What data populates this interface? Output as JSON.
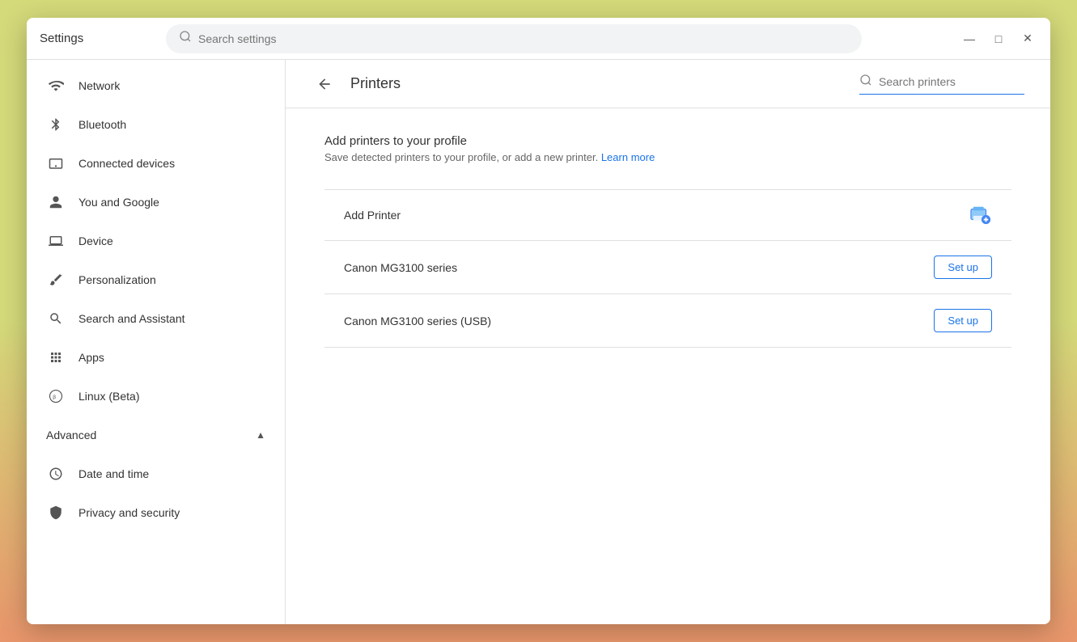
{
  "window": {
    "title": "Settings",
    "controls": {
      "minimize": "—",
      "maximize": "□",
      "close": "✕"
    }
  },
  "header": {
    "search_placeholder": "Search settings"
  },
  "sidebar": {
    "items": [
      {
        "id": "network",
        "label": "Network",
        "icon": "wifi"
      },
      {
        "id": "bluetooth",
        "label": "Bluetooth",
        "icon": "bluetooth"
      },
      {
        "id": "connected-devices",
        "label": "Connected devices",
        "icon": "tablet"
      },
      {
        "id": "you-and-google",
        "label": "You and Google",
        "icon": "person"
      },
      {
        "id": "device",
        "label": "Device",
        "icon": "laptop"
      },
      {
        "id": "personalization",
        "label": "Personalization",
        "icon": "brush"
      },
      {
        "id": "search-and-assistant",
        "label": "Search and Assistant",
        "icon": "search"
      },
      {
        "id": "apps",
        "label": "Apps",
        "icon": "apps"
      },
      {
        "id": "linux-beta",
        "label": "Linux (Beta)",
        "icon": "linux"
      }
    ],
    "advanced": {
      "label": "Advanced",
      "expanded": true,
      "items": [
        {
          "id": "date-and-time",
          "label": "Date and time",
          "icon": "clock"
        },
        {
          "id": "privacy-and-security",
          "label": "Privacy and security",
          "icon": "shield"
        }
      ]
    }
  },
  "main": {
    "back_label": "←",
    "page_title": "Printers",
    "search_placeholder": "Search printers",
    "add_section": {
      "title": "Add printers to your profile",
      "description": "Save detected printers to your profile, or add a new printer.",
      "learn_more": "Learn more"
    },
    "printers": [
      {
        "id": "add-printer",
        "label": "Add Printer",
        "action": "icon"
      },
      {
        "id": "canon-mg3100",
        "label": "Canon MG3100 series",
        "action": "setup",
        "button_label": "Set up"
      },
      {
        "id": "canon-mg3100-usb",
        "label": "Canon MG3100 series (USB)",
        "action": "setup",
        "button_label": "Set up"
      }
    ]
  },
  "colors": {
    "accent": "#1a73e8",
    "text_primary": "#333",
    "text_secondary": "#666",
    "border": "#e0e0e0"
  }
}
